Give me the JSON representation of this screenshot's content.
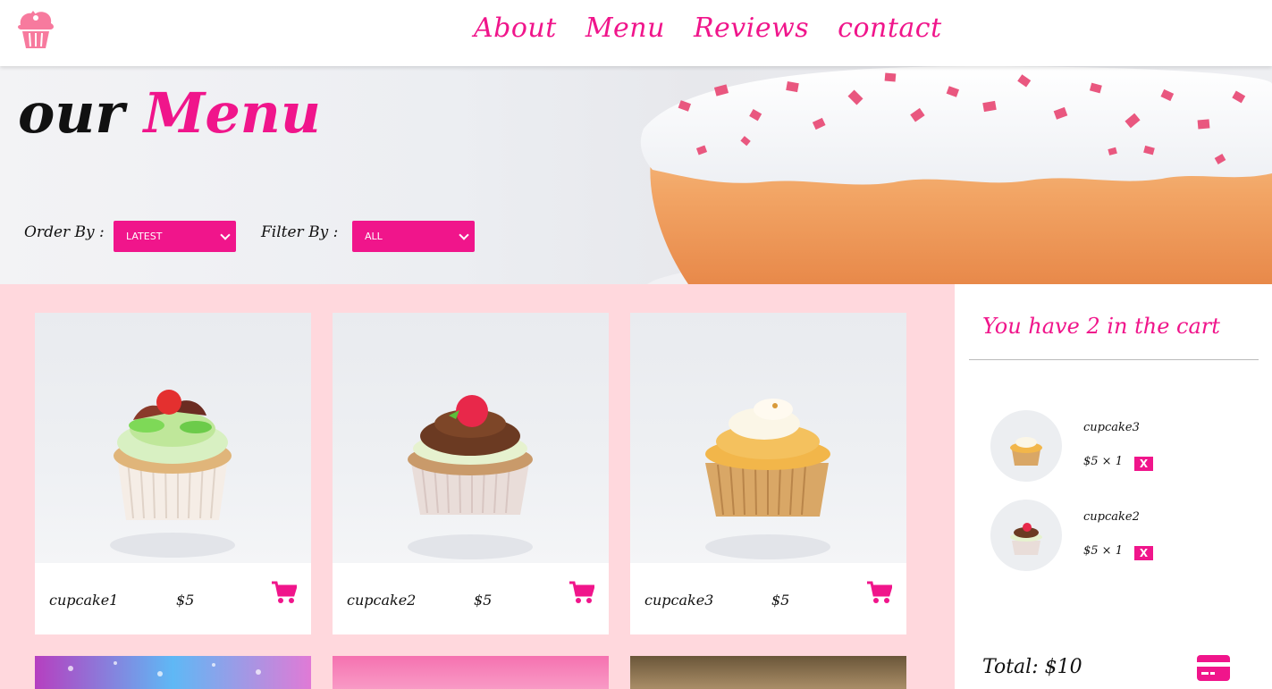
{
  "brand": {
    "logo_icon": "cupcake-logo-icon"
  },
  "nav": {
    "items": [
      {
        "label": "About"
      },
      {
        "label": "Menu"
      },
      {
        "label": "Reviews"
      },
      {
        "label": "contact"
      }
    ]
  },
  "hero": {
    "title_part1": "our",
    "title_part2": "Menu",
    "order_by_label": "Order By :",
    "order_by_value": "LATEST",
    "filter_by_label": "Filter By :",
    "filter_by_value": "ALL"
  },
  "products": [
    {
      "name": "cupcake1",
      "price": "$5",
      "icon": "cart-icon"
    },
    {
      "name": "cupcake2",
      "price": "$5",
      "icon": "cart-icon"
    },
    {
      "name": "cupcake3",
      "price": "$5",
      "icon": "cart-icon"
    }
  ],
  "cart": {
    "title": "You have 2 in the cart",
    "items": [
      {
        "name": "cupcake3",
        "qty": "$5 × 1",
        "remove": "X"
      },
      {
        "name": "cupcake2",
        "qty": "$5 × 1",
        "remove": "X"
      }
    ],
    "total": "Total: $10",
    "pay_icon": "credit-card-icon"
  },
  "colors": {
    "accent": "#f0158b",
    "grid_bg": "#ffd8dd"
  }
}
